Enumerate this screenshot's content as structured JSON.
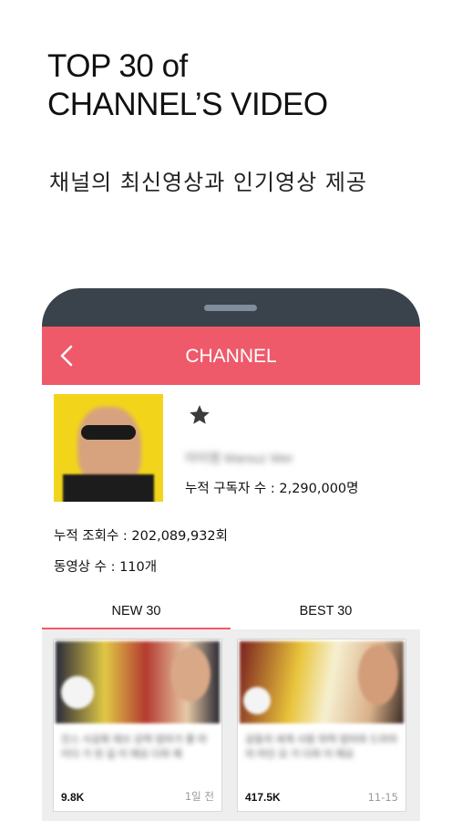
{
  "promo": {
    "headline_line1": "TOP 30 of",
    "headline_line2": "CHANNEL’S VIDEO",
    "subheadline": "채널의 최신영상과 인기영상 제공"
  },
  "appbar": {
    "title": "CHANNEL",
    "back_icon": "chevron-left-icon",
    "color": "#ee5a6a"
  },
  "channel": {
    "favorite_icon": "star-icon",
    "name": "아미엠 Warsuz Wer",
    "subscribers": "누적 구독자 수 : 2,290,000명",
    "total_views": "누적 조회수 : 202,089,932회",
    "video_count": "동영상 수 : 110개"
  },
  "tabs": [
    {
      "label": "NEW 30",
      "active": true
    },
    {
      "label": "BEST 30",
      "active": false
    }
  ],
  "videos": [
    {
      "title": "진스 사공화 레쓰 강력 엄마가 좋 마이다 가 된 길 이 에요 다와 왜",
      "views": "9.8K",
      "date": "1일 전"
    },
    {
      "title": "공동의 세계 사람 위력 엄마와 드라마 의 마인 요 거 다와 이 에요",
      "views": "417.5K",
      "date": "11-15"
    }
  ],
  "colors": {
    "phone_frame": "#3a424b",
    "accent": "#ee5a6a"
  }
}
